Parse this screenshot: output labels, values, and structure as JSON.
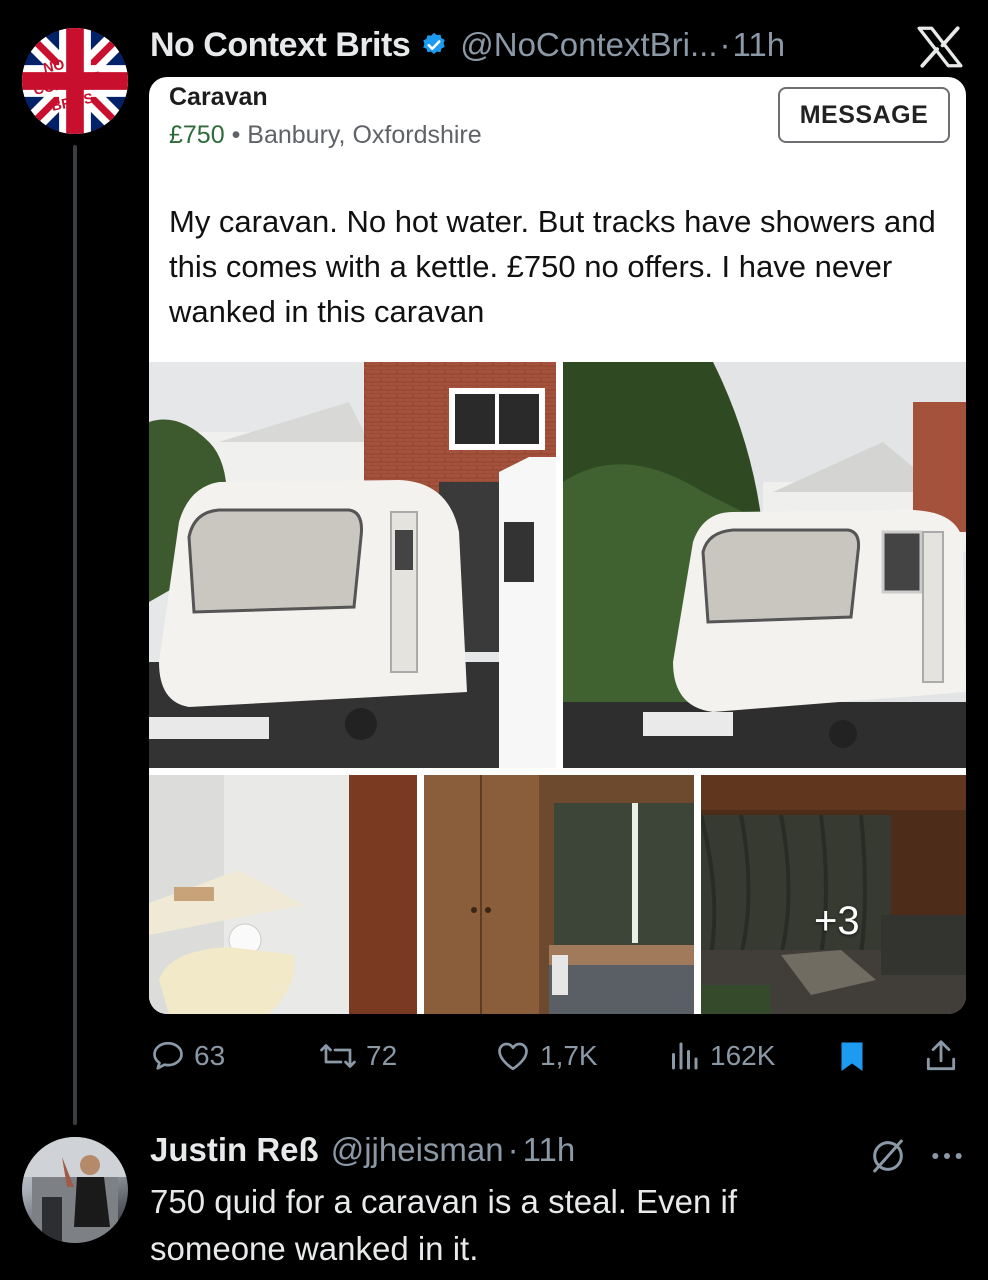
{
  "tweet": {
    "author_name": "No Context Brits",
    "author_handle": "@NoContextBri...",
    "time": "11h",
    "separator": "·",
    "avatar_text": "NO CONTEXT BRITS",
    "card": {
      "title": "Caravan",
      "price": "£750",
      "location": "Banbury, Oxfordshire",
      "meta_separator": "•",
      "message_button": "MESSAGE",
      "description": "My caravan. No hot water. But tracks have showers and this comes with a kettle. £750 no offers. I have never wanked in this caravan",
      "more_photos": "+3"
    },
    "actions": {
      "replies": "63",
      "reposts": "72",
      "likes": "1,7K",
      "views": "162K"
    }
  },
  "reply": {
    "author_name": "Justin Reß",
    "author_handle": "@jjheisman",
    "separator": "·",
    "time": "11h",
    "text": "750 quid for a caravan is a steal. Even if someone wanked in it."
  },
  "colors": {
    "background": "#000000",
    "text": "#e7e9ea",
    "muted": "#8b98a5",
    "verified": "#1d9bf0",
    "bookmark_active": "#1d9bf0",
    "price_green": "#2e6b3a"
  },
  "icons": [
    "verified-badge-icon",
    "x-logo-icon",
    "reply-icon",
    "repost-icon",
    "like-icon",
    "views-icon",
    "bookmark-icon",
    "share-icon",
    "grok-icon",
    "more-icon"
  ]
}
